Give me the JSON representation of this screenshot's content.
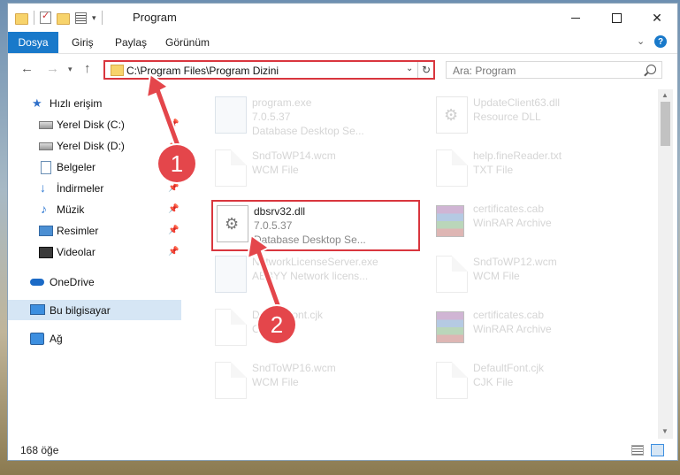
{
  "window": {
    "title": "Program"
  },
  "ribbon": {
    "tabs": [
      "Dosya",
      "Giriş",
      "Paylaş",
      "Görünüm"
    ]
  },
  "address": {
    "path": "C:\\Program Files\\Program Dizini"
  },
  "search": {
    "placeholder": "Ara: Program"
  },
  "nav": {
    "items": [
      {
        "label": "Hızlı erişim",
        "icon": "star-icon"
      },
      {
        "label": "Yerel Disk (C:)",
        "icon": "drive-icon"
      },
      {
        "label": "Yerel Disk (D:)",
        "icon": "drive-icon"
      },
      {
        "label": "Belgeler",
        "icon": "document-icon"
      },
      {
        "label": "İndirmeler",
        "icon": "download-icon"
      },
      {
        "label": "Müzik",
        "icon": "music-icon"
      },
      {
        "label": "Resimler",
        "icon": "pictures-icon"
      },
      {
        "label": "Videolar",
        "icon": "video-icon"
      },
      {
        "label": "OneDrive",
        "icon": "cloud-icon"
      },
      {
        "label": "Bu bilgisayar",
        "icon": "computer-icon"
      },
      {
        "label": "Ağ",
        "icon": "network-icon"
      }
    ]
  },
  "files": [
    {
      "name": "program.exe",
      "line2": "7.0.5.37",
      "line3": "Database Desktop Se..."
    },
    {
      "name": "UpdateClient63.dll",
      "line2": "Resource DLL",
      "line3": ""
    },
    {
      "name": "SndToWP14.wcm",
      "line2": "WCM File",
      "line3": ""
    },
    {
      "name": "help.fineReader.txt",
      "line2": "TXT File",
      "line3": ""
    },
    {
      "name": "dbsrv32.dll",
      "line2": "7.0.5.37",
      "line3": "Database Desktop Se..."
    },
    {
      "name": "certificates.cab",
      "line2": "WinRAR Archive",
      "line3": ""
    },
    {
      "name": "NetworkLicenseServer.exe",
      "line2": "ABBYY Network licens...",
      "line3": ""
    },
    {
      "name": "SndToWP12.wcm",
      "line2": "WCM File",
      "line3": ""
    },
    {
      "name": "DefaultFont.cjk",
      "line2": "CJK File",
      "line3": ""
    },
    {
      "name": "certificates.cab",
      "line2": "WinRAR Archive",
      "line3": ""
    },
    {
      "name": "SndToWP16.wcm",
      "line2": "WCM File",
      "line3": ""
    },
    {
      "name": "DefaultFont.cjk",
      "line2": "CJK File",
      "line3": ""
    }
  ],
  "status": {
    "count": "168 öğe"
  },
  "annotations": {
    "step1": "1",
    "step2": "2",
    "accent": "#e4464b"
  }
}
